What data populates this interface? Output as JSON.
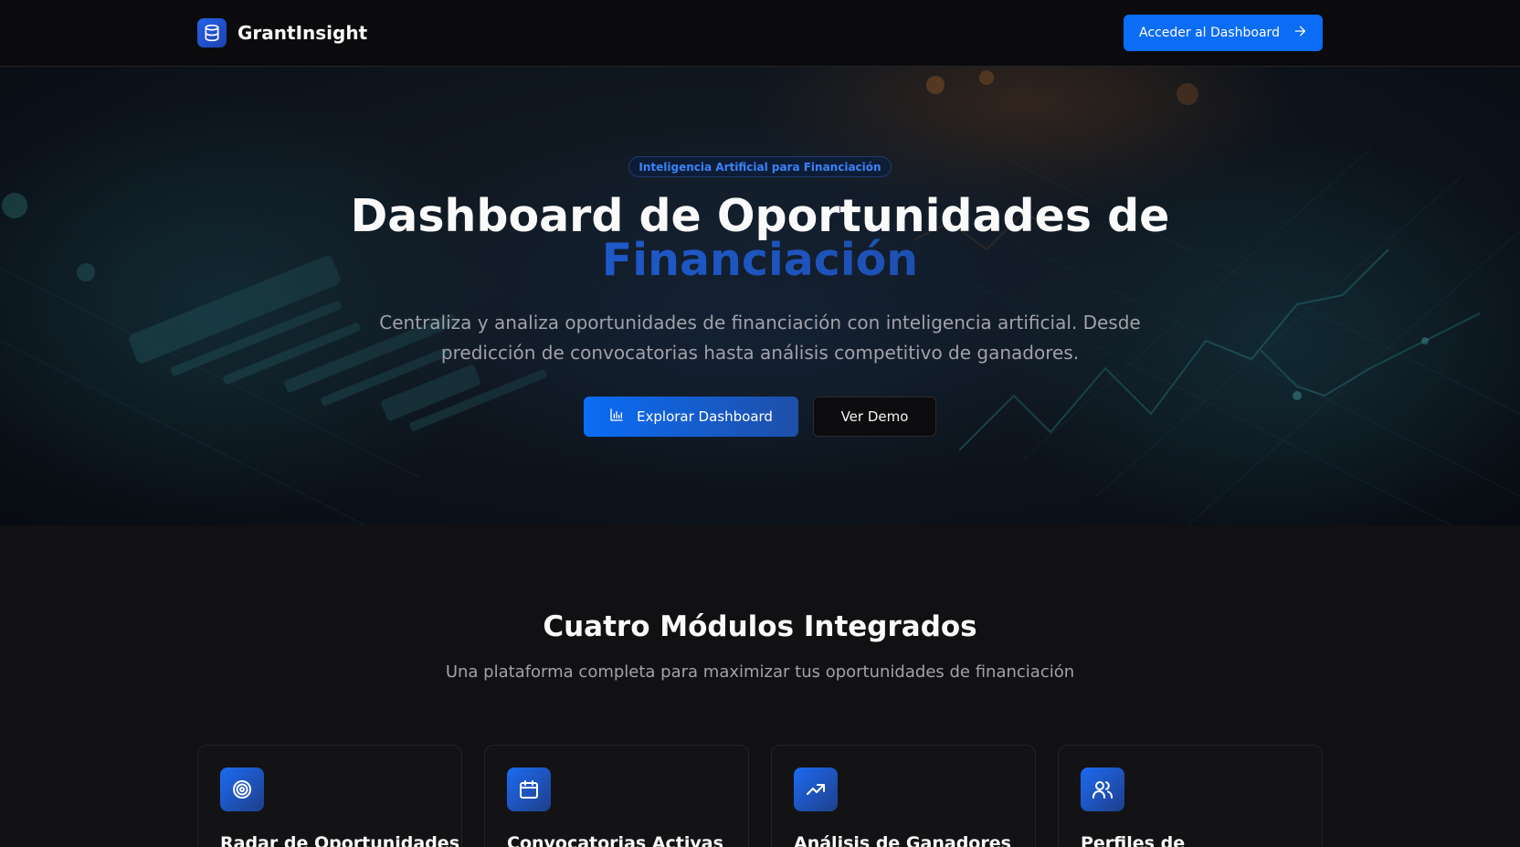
{
  "brand": {
    "name": "GrantInsight",
    "icon": "database-icon"
  },
  "nav": {
    "cta_label": "Acceder al Dashboard",
    "cta_icon": "arrow-right-icon"
  },
  "hero": {
    "badge": "Inteligencia Artificial para Financiación",
    "title_main": "Dashboard de Oportunidades de",
    "title_accent": "Financiación",
    "subtitle": "Centraliza y analiza oportunidades de financiación con inteligencia artificial. Desde predicción de convocatorias hasta análisis competitivo de ganadores.",
    "primary_button": {
      "label": "Explorar Dashboard",
      "icon": "bar-chart-icon"
    },
    "secondary_button": {
      "label": "Ver Demo"
    }
  },
  "modules": {
    "title": "Cuatro Módulos Integrados",
    "subtitle": "Una plataforma completa para maximizar tus oportunidades de financiación",
    "cards": [
      {
        "title": "Radar de Oportunidades",
        "icon": "target-icon"
      },
      {
        "title": "Convocatorias Activas",
        "icon": "calendar-icon"
      },
      {
        "title": "Análisis de Ganadores",
        "icon": "trending-up-icon"
      },
      {
        "title": "Perfiles de",
        "icon": "users-icon"
      }
    ]
  },
  "colors": {
    "accent": "#0b6cf5",
    "background": "#111113",
    "nav_background": "#0b0b0d",
    "muted_text": "#a1a1aa"
  }
}
